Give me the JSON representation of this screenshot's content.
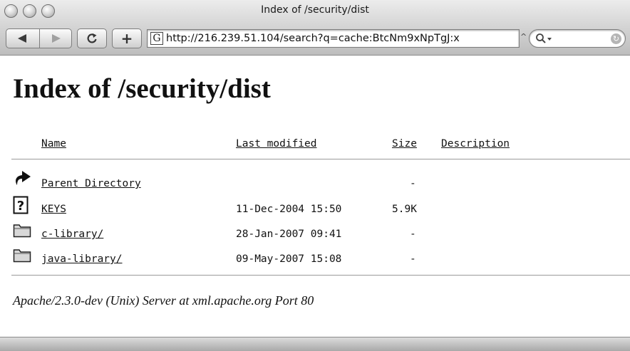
{
  "window": {
    "title": "Index of /security/dist"
  },
  "toolbar": {
    "reload_label": "ↄ",
    "add_label": "+",
    "favicon_label": "G",
    "url": "http://216.239.51.104/search?q=cache:BtcNm9xNpTgJ:x",
    "url_caret": "^",
    "search_placeholder": ""
  },
  "page": {
    "heading": "Index of /security/dist",
    "columns": {
      "name": "Name",
      "last_modified": "Last modified",
      "size": "Size",
      "description": "Description"
    },
    "entries": [
      {
        "icon": "parent-directory-icon",
        "name": "Parent Directory",
        "modified": "",
        "size": "-"
      },
      {
        "icon": "unknown-file-icon",
        "name": "KEYS",
        "modified": "11-Dec-2004 15:50",
        "size": "5.9K"
      },
      {
        "icon": "folder-icon",
        "name": "c-library/",
        "modified": "28-Jan-2007 09:41",
        "size": "-"
      },
      {
        "icon": "folder-icon",
        "name": "java-library/",
        "modified": "09-May-2007 15:08",
        "size": "-"
      }
    ],
    "server_signature": "Apache/2.3.0-dev (Unix) Server at xml.apache.org Port 80"
  }
}
